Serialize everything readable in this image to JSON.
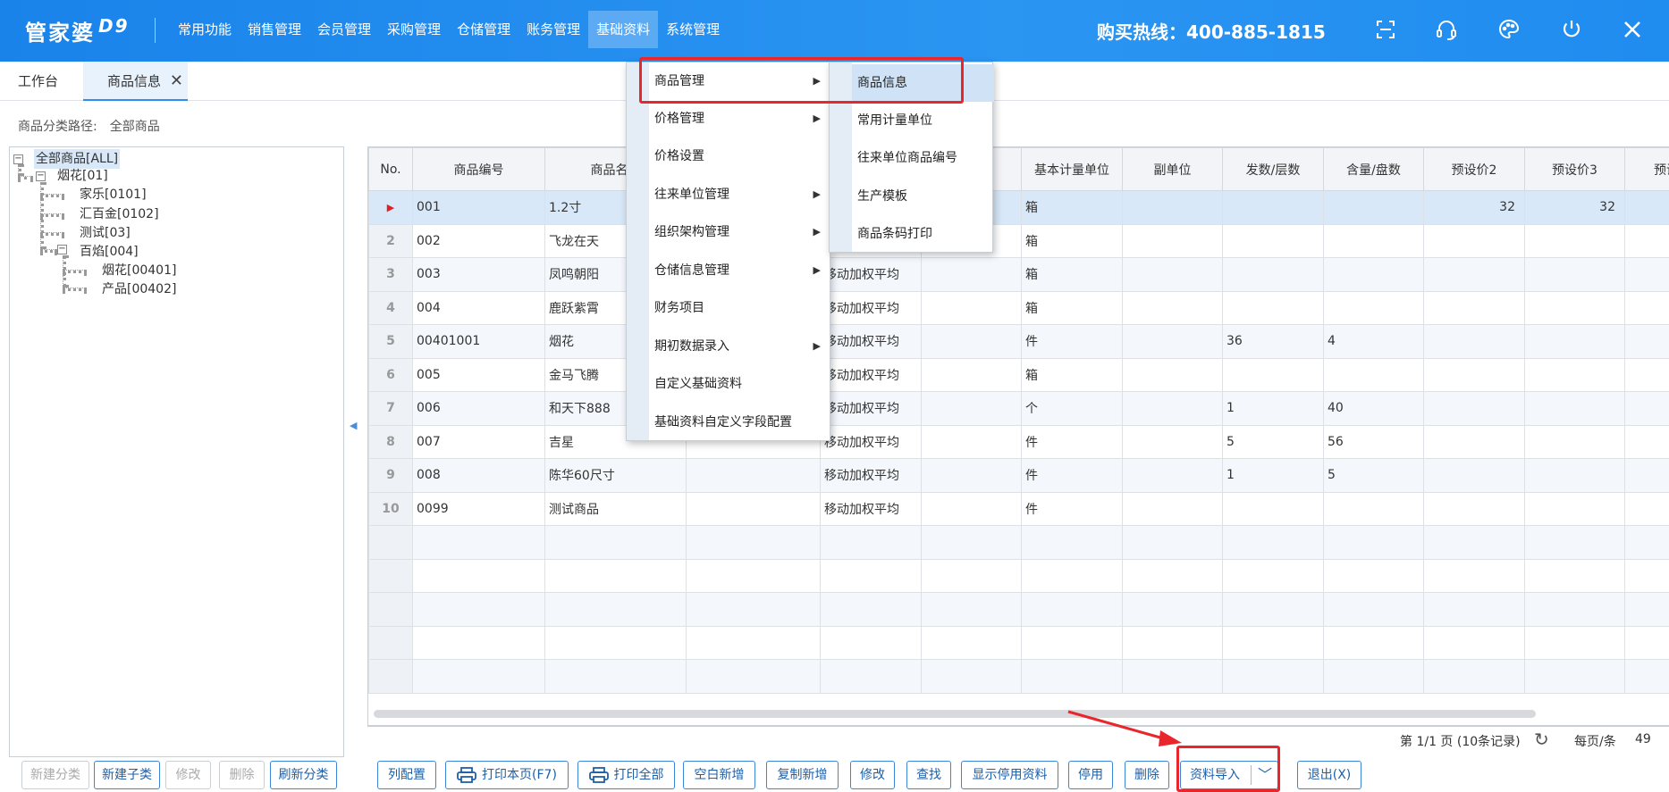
{
  "app": {
    "logo": "管家婆",
    "logo_suffix": "D9",
    "hotline": "购买热线：400-885-1815"
  },
  "nav": [
    "常用功能",
    "销售管理",
    "会员管理",
    "采购管理",
    "仓储管理",
    "账务管理",
    "基础资料",
    "系统管理"
  ],
  "top_icons": [
    "fullscreen-icon",
    "headset-icon",
    "palette-icon",
    "power-icon",
    "close-icon"
  ],
  "tabs": [
    {
      "label": "工作台"
    },
    {
      "label": "商品信息"
    }
  ],
  "path": {
    "label": "商品分类路径:",
    "value": "全部商品"
  },
  "tree": [
    {
      "label": "全部商品[ALL]"
    },
    {
      "label": "烟花[01]"
    },
    {
      "label": "家乐[0101]"
    },
    {
      "label": "汇百金[0102]"
    },
    {
      "label": "测试[03]"
    },
    {
      "label": "百焰[004]"
    },
    {
      "label": "烟花[00401]"
    },
    {
      "label": "产品[00402]"
    }
  ],
  "grid": {
    "columns": [
      "No.",
      "商品编号",
      "商品名称",
      "",
      "",
      "",
      "基本计量单位",
      "副单位",
      "发数/层数",
      "含量/盘数",
      "预设价2",
      "预设价3",
      "预设"
    ],
    "rows": [
      {
        "no": "",
        "code": "001",
        "name": "1.2寸",
        "c3": "",
        "c4": "",
        "c5": "",
        "unit": "箱",
        "sub": "",
        "fa": "",
        "han": "",
        "p2": "32",
        "p3": "32"
      },
      {
        "no": "2",
        "code": "002",
        "name": "飞龙在天",
        "c3": "",
        "c4": "",
        "c5": "",
        "unit": "箱",
        "sub": "",
        "fa": "",
        "han": "",
        "p2": "",
        "p3": ""
      },
      {
        "no": "3",
        "code": "003",
        "name": "凤鸣朝阳",
        "c3": "",
        "c4": "移动加权平均",
        "c5": "",
        "unit": "箱",
        "sub": "",
        "fa": "",
        "han": "",
        "p2": "",
        "p3": ""
      },
      {
        "no": "4",
        "code": "004",
        "name": "鹿跃紫霄",
        "c3": "",
        "c4": "移动加权平均",
        "c5": "",
        "unit": "箱",
        "sub": "",
        "fa": "",
        "han": "",
        "p2": "",
        "p3": ""
      },
      {
        "no": "5",
        "code": "00401001",
        "name": "烟花",
        "c3": "",
        "c4": "移动加权平均",
        "c5": "",
        "unit": "件",
        "sub": "",
        "fa": "36",
        "han": "4",
        "p2": "",
        "p3": ""
      },
      {
        "no": "6",
        "code": "005",
        "name": "金马飞腾",
        "c3": "",
        "c4": "移动加权平均",
        "c5": "",
        "unit": "箱",
        "sub": "",
        "fa": "",
        "han": "",
        "p2": "",
        "p3": ""
      },
      {
        "no": "7",
        "code": "006",
        "name": "和天下888",
        "c3": "",
        "c4": "移动加权平均",
        "c5": "",
        "unit": "个",
        "sub": "",
        "fa": "1",
        "han": "40",
        "p2": "",
        "p3": ""
      },
      {
        "no": "8",
        "code": "007",
        "name": "吉星",
        "c3": "",
        "c4": "移动加权平均",
        "c5": "",
        "unit": "件",
        "sub": "",
        "fa": "5",
        "han": "56",
        "p2": "",
        "p3": ""
      },
      {
        "no": "9",
        "code": "008",
        "name": "陈华60尺寸",
        "c3": "",
        "c4": "移动加权平均",
        "c5": "",
        "unit": "件",
        "sub": "",
        "fa": "1",
        "han": "5",
        "p2": "",
        "p3": ""
      },
      {
        "no": "10",
        "code": "0099",
        "name": "测试商品",
        "c3": "",
        "c4": "移动加权平均",
        "c5": "",
        "unit": "件",
        "sub": "",
        "fa": "",
        "han": "",
        "p2": "",
        "p3": ""
      }
    ],
    "empty_rows": 5
  },
  "pager": {
    "info": "第 1/1 页 (10条记录)",
    "page_size_label": "每页/条",
    "page_size": "49"
  },
  "left_buttons": [
    "新建分类",
    "新建子类",
    "修改",
    "删除",
    "刷新分类"
  ],
  "right_buttons": [
    "列配置",
    "打印本页(F7)",
    "打印全部",
    "空白新增",
    "复制新增",
    "修改",
    "查找",
    "显示停用资料",
    "停用",
    "删除",
    "资料导入",
    "退出(X)"
  ],
  "menu_main": [
    "商品管理",
    "价格管理",
    "价格设置",
    "往来单位管理",
    "组织架构管理",
    "仓储信息管理",
    "财务项目",
    "期初数据录入",
    "自定义基础资料",
    "基础资料自定义字段配置"
  ],
  "menu_sub": [
    "商品信息",
    "常用计量单位",
    "往来单位商品编号",
    "生产模板",
    "商品条码打印"
  ],
  "colors": {
    "topbar": "#1f8cef",
    "accent": "#3b86d8",
    "highlight": "#e8262b"
  }
}
